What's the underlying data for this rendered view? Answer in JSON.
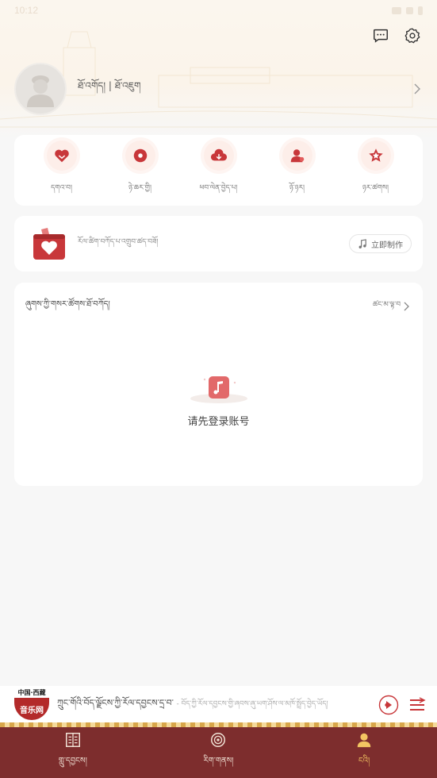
{
  "status_bar": {
    "time": "10:12"
  },
  "header": {
    "message_icon": "chat-icon",
    "settings_icon": "gear-icon"
  },
  "profile": {
    "login_prompt": "ཐོ་འགོད། | ཐོ་འཇུག"
  },
  "features": [
    {
      "label": "དགའ་བ།",
      "icon": "heart-icon"
    },
    {
      "label": "ཉེ་ཆར་གྱི།",
      "icon": "disc-icon"
    },
    {
      "label": "ཕབ་ལེན་བྱེད་པ།",
      "icon": "cloud-download-icon"
    },
    {
      "label": "ཉོ་ཉར།",
      "icon": "singer-icon"
    },
    {
      "label": "ཉར་ཚགས།",
      "icon": "star-icon"
    }
  ],
  "make_card": {
    "text": "རོལ་ཚིག་བཀོད་པ་འགྲུབ་ཚད་བཟོ།",
    "button_label": "立即制作"
  },
  "playlist_section": {
    "title": "ཞུགས་ཀྱི་གསར་ཚོགས་ཐོ་བཀོད།",
    "more_label": "ཚང་མ་ལྟ་བ",
    "empty_text": "请先登录账号"
  },
  "player": {
    "logo_top": "中国·西藏",
    "logo_name": "音乐网",
    "song_title": "ཀྲུང་གོའི་བོད་ལྗོངས་ཀྱི་རོལ་དབྱངས་དྲ་བ་",
    "song_artist": "- བོད་ཀྱི་རོལ་དབྱངས་གྱི་ཞབས་ཞུ་ཡག་ཤོས་ལ་མཁོ་སྤྲོད་བྱེད་ཡོད།"
  },
  "tabs": [
    {
      "label": "གླུ་དབྱངས།",
      "icon": "music-book-icon",
      "active": false
    },
    {
      "label": "རིག་གནས།",
      "icon": "culture-icon",
      "active": false
    },
    {
      "label": "ངའི།",
      "icon": "user-icon",
      "active": true
    }
  ],
  "colors": {
    "accent": "#c8373a",
    "tab_bar": "#7d2d2d",
    "active_tab": "#f3c662"
  }
}
